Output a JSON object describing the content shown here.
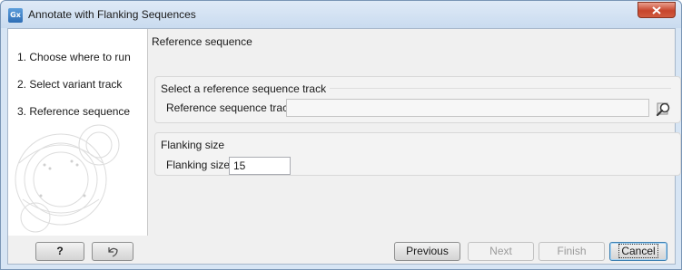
{
  "window": {
    "title": "Annotate with Flanking Sequences",
    "app_icon_text": "Gx"
  },
  "sidebar": {
    "steps": [
      {
        "number": "1.",
        "label": "Choose where to run",
        "text": "1.  Choose where to run"
      },
      {
        "number": "2.",
        "label": "Select variant track",
        "text": "2.  Select variant track"
      },
      {
        "number": "3.",
        "label": "Reference sequence",
        "text": "3.  Reference sequence"
      }
    ],
    "active_step": 3
  },
  "content": {
    "section_header": "Reference sequence",
    "reference_group": {
      "title": "Select a reference sequence track",
      "field_label": "Reference sequence track",
      "field_value": ""
    },
    "flanking_group": {
      "title": "Flanking size",
      "field_label": "Flanking size",
      "field_value": "15"
    }
  },
  "footer": {
    "help_label": "?",
    "previous_label": "Previous",
    "next_label": "Next",
    "finish_label": "Finish",
    "cancel_label": "Cancel"
  },
  "icons": {
    "browse": "magnifier-browse-icon",
    "reset": "reset-arrow-icon",
    "close": "close-icon"
  },
  "colors": {
    "titlebar": "#d7e5f4",
    "close_button": "#c7452c",
    "default_button_border": "#3c7fb1"
  }
}
